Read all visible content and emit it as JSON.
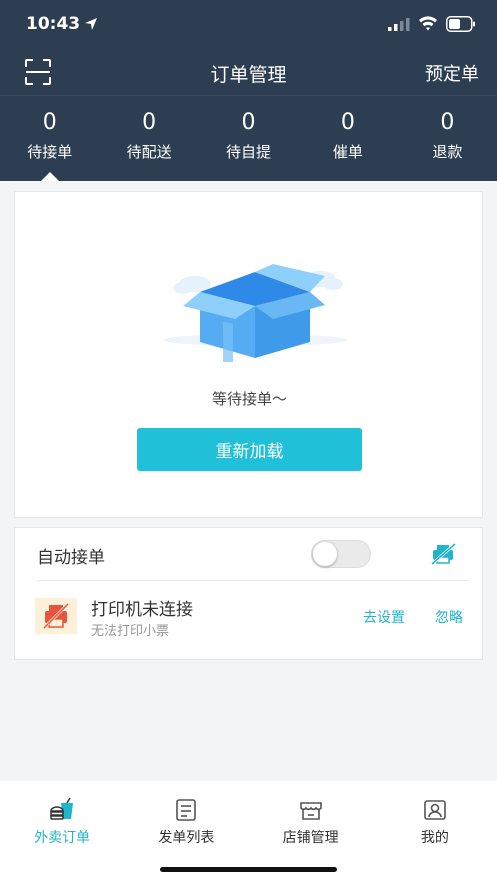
{
  "status_bar": {
    "time": "10:43",
    "icons": [
      "location-arrow-icon",
      "signal-icon",
      "wifi-icon",
      "battery-icon"
    ]
  },
  "nav": {
    "left_icon": "scan-icon",
    "title": "订单管理",
    "right_label": "预定单"
  },
  "stats": [
    {
      "count": "0",
      "label": "待接单",
      "active": true
    },
    {
      "count": "0",
      "label": "待配送",
      "active": false
    },
    {
      "count": "0",
      "label": "待自提",
      "active": false
    },
    {
      "count": "0",
      "label": "催单",
      "active": false
    },
    {
      "count": "0",
      "label": "退款",
      "active": false
    }
  ],
  "empty_state": {
    "illustration": "empty-box-icon",
    "message": "等待接单～",
    "reload_label": "重新加载"
  },
  "auto_accept": {
    "label": "自动接单",
    "enabled": false,
    "icon": "printer-link-icon"
  },
  "printer": {
    "icon": "printer-warning-icon",
    "title": "打印机未连接",
    "subtitle": "无法打印小票",
    "settings_label": "去设置",
    "ignore_label": "忽略"
  },
  "tabs": [
    {
      "label": "外卖订单",
      "icon": "takeout-icon",
      "active": true
    },
    {
      "label": "发单列表",
      "icon": "order-list-icon",
      "active": false
    },
    {
      "label": "店铺管理",
      "icon": "store-icon",
      "active": false
    },
    {
      "label": "我的",
      "icon": "profile-icon",
      "active": false
    }
  ],
  "colors": {
    "header_bg": "#2e3e52",
    "accent": "#21b5cc",
    "button": "#20c0d9",
    "page_bg": "#f3f4f6"
  }
}
